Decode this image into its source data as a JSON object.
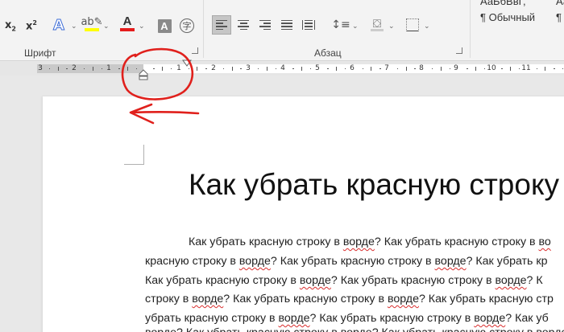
{
  "ribbon": {
    "font_group": {
      "label": "Шрифт",
      "subscript_icon": "subscript-icon",
      "superscript_icon": "superscript-icon",
      "text_effects_icon": "text-effects-icon",
      "highlight_icon": "highlighter-icon",
      "highlight_color": "#ffff00",
      "font_color_icon": "font-color-icon",
      "font_color_glyph": "A",
      "font_color": "#e51c1c",
      "shading_glyph": "A",
      "enclose_glyph": "字"
    },
    "paragraph_group": {
      "label": "Абзац",
      "active_alignment": "align-left"
    },
    "styles": [
      {
        "preview": "АаБбВвГ,",
        "name": "¶ Обычный"
      },
      {
        "preview": "Аа",
        "name": "¶ Бе"
      }
    ]
  },
  "ruler": {
    "numbers": [
      {
        "label": "3"
      },
      {
        "label": "2"
      },
      {
        "label": "1"
      },
      {
        "label": "1"
      },
      {
        "label": "2"
      },
      {
        "label": "3"
      },
      {
        "label": "4"
      },
      {
        "label": "5"
      },
      {
        "label": "6"
      },
      {
        "label": "7"
      },
      {
        "label": "8"
      },
      {
        "label": "9"
      },
      {
        "label": "10"
      },
      {
        "label": "11"
      }
    ]
  },
  "document": {
    "title": "Как убрать красную строку в",
    "lines": [
      [
        {
          "t": "Как убрать красную строку в "
        },
        {
          "t": "ворде",
          "s": true
        },
        {
          "t": "? Как убрать красную строку в "
        },
        {
          "t": "во",
          "s": true
        }
      ],
      [
        {
          "t": "красную строку в "
        },
        {
          "t": "ворде",
          "s": true
        },
        {
          "t": "? Как убрать красную строку в "
        },
        {
          "t": "ворде",
          "s": true
        },
        {
          "t": "? Как убрать кр"
        }
      ],
      [
        {
          "t": "Как убрать красную строку в "
        },
        {
          "t": "ворде",
          "s": true
        },
        {
          "t": "? Как убрать красную строку в "
        },
        {
          "t": "ворде",
          "s": true
        },
        {
          "t": "? К"
        }
      ],
      [
        {
          "t": "строку в "
        },
        {
          "t": "ворде",
          "s": true
        },
        {
          "t": "? Как убрать красную строку в "
        },
        {
          "t": "ворде",
          "s": true
        },
        {
          "t": "? Как убрать красную стр"
        }
      ],
      [
        {
          "t": "убрать красную строку в "
        },
        {
          "t": "ворде",
          "s": true
        },
        {
          "t": "? Как убрать красную строку в "
        },
        {
          "t": "ворде",
          "s": true
        },
        {
          "t": "? Как уб"
        }
      ],
      [
        {
          "t": "ворде",
          "s": true
        },
        {
          "t": "? Как убрать красную строку в "
        },
        {
          "t": "ворде",
          "s": true
        },
        {
          "t": "? Как убрать красную строку в "
        },
        {
          "t": "ворде",
          "s": true
        }
      ]
    ]
  },
  "annotation": {
    "color": "#e0201c",
    "shapes": [
      "circle-around-indent-marker",
      "arrow-pointing-left"
    ]
  }
}
